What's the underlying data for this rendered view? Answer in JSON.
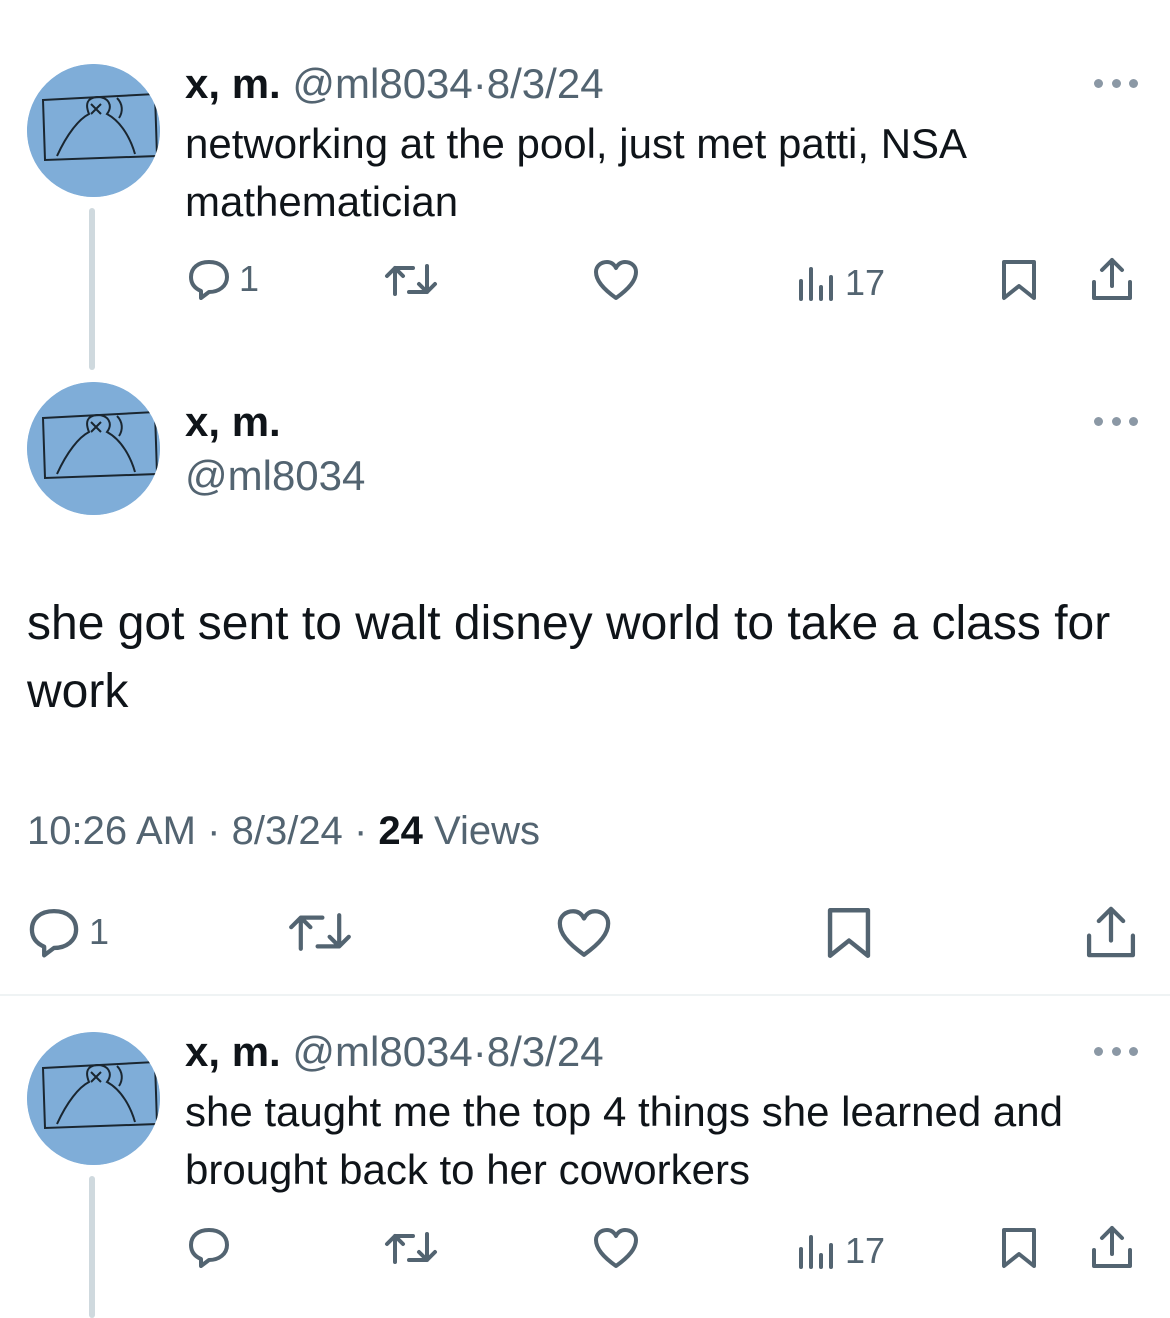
{
  "tweet1": {
    "name": "x, m.",
    "handle": "@ml8034",
    "separator": "·",
    "date": "8/3/24",
    "text": "networking at the pool, just met patti, NSA mathematician",
    "reply_count": "1",
    "views": "17"
  },
  "main_tweet": {
    "name": "x, m.",
    "handle": "@ml8034",
    "text": "she got sent to walt disney world to take a class for work",
    "time": "10:26 AM",
    "sep1": "·",
    "date": "8/3/24",
    "sep2": "·",
    "views_count": "24",
    "views_label": "Views",
    "reply_count": "1"
  },
  "tweet3": {
    "name": "x, m.",
    "handle": "@ml8034",
    "separator": "·",
    "date": "8/3/24",
    "text": "she taught me the top 4 things she learned and brought back to her coworkers",
    "views": "17"
  },
  "colors": {
    "text": "#0f1419",
    "secondary": "#536471",
    "avatar_bg": "#7fadd8",
    "thread_line": "#cfd9de"
  },
  "icons": [
    "more-icon",
    "reply-icon",
    "retweet-icon",
    "like-icon",
    "views-icon",
    "bookmark-icon",
    "share-icon"
  ]
}
